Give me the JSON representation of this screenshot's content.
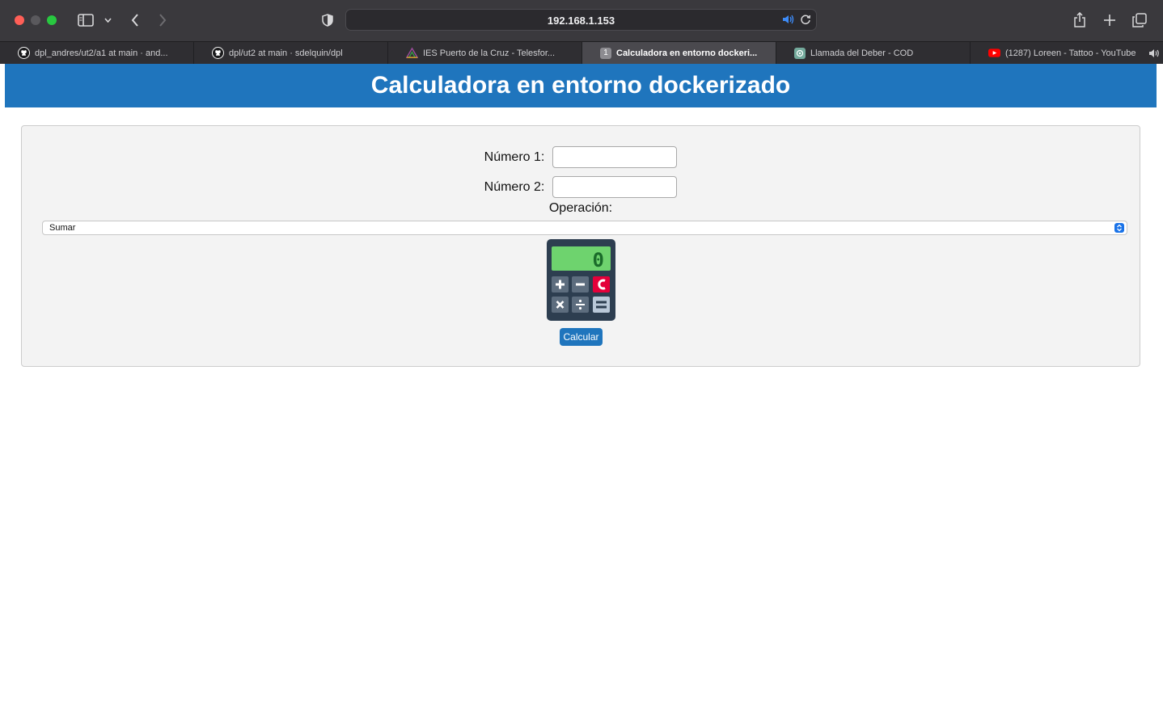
{
  "browser": {
    "url": "192.168.1.153",
    "tabs": [
      {
        "label": "dpl_andres/ut2/a1 at main · and...",
        "icon": "github-icon",
        "active": false
      },
      {
        "label": "dpl/ut2 at main · sdelquin/dpl",
        "icon": "github-icon",
        "active": false
      },
      {
        "label": "IES Puerto de la Cruz - Telesfor...",
        "icon": "school-icon",
        "active": false
      },
      {
        "label": "Calculadora en entorno dockeri...",
        "icon": "tab-number-icon",
        "active": true,
        "badge": "1"
      },
      {
        "label": "Llamada del Deber - COD",
        "icon": "chatgpt-icon",
        "active": false
      },
      {
        "label": "(1287) Loreen - Tattoo - YouTube",
        "icon": "youtube-icon",
        "active": false
      }
    ]
  },
  "page": {
    "title": "Calculadora en entorno dockerizado",
    "form": {
      "num1_label": "Número 1:",
      "num1_value": "",
      "num2_label": "Número 2:",
      "num2_value": "",
      "operation_label": "Operación:",
      "operation_selected": "Sumar",
      "calc_display": "0",
      "submit_label": "Calcular"
    }
  },
  "colors": {
    "accent": "#1f75bd",
    "panel_bg": "#f3f3f3"
  }
}
